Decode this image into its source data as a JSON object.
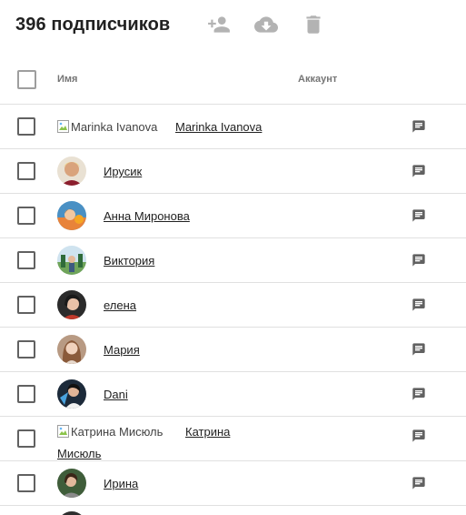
{
  "header": {
    "title": "396 подписчиков",
    "icons": [
      "add-person-icon",
      "cloud-download-icon",
      "trash-icon"
    ],
    "icon_color": "#b3b3b3"
  },
  "table": {
    "columns": {
      "name": "Имя",
      "account": "Аккаунт"
    },
    "rows": [
      {
        "name": "Marinka Ivanova",
        "avatar_alt": "Marinka Ivanova",
        "avatar_broken": true
      },
      {
        "name": "Ирусик"
      },
      {
        "name": "Анна Миронова"
      },
      {
        "name": "Виктория"
      },
      {
        "name": "елена"
      },
      {
        "name": "Мария"
      },
      {
        "name": "Dani"
      },
      {
        "name": "Катрина Мисюль",
        "name_line1": "Катрина",
        "name_line2": "Мисюль",
        "avatar_alt": "Катрина Мисюль",
        "avatar_broken": true
      },
      {
        "name": "Ирина"
      }
    ]
  },
  "colors": {
    "row_divider": "#e0e0e0",
    "icon": "#616161",
    "text": "#212121"
  }
}
